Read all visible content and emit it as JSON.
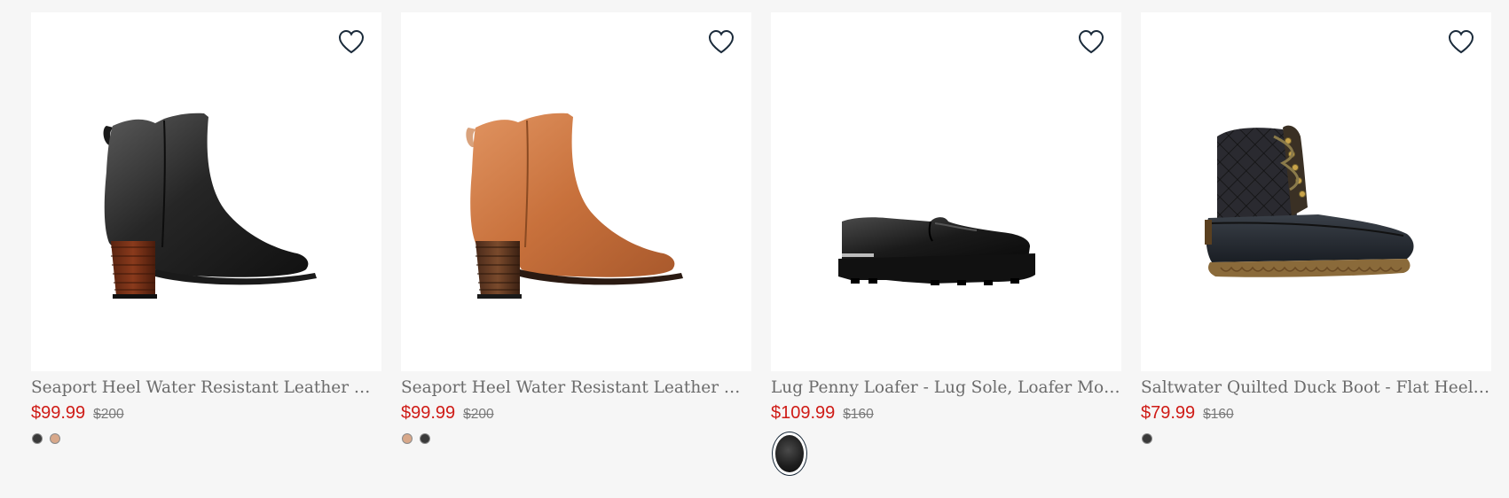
{
  "products": [
    {
      "name": "Seaport Heel Water Resistant Leather Boot - Heeled Bootie, Leather Ankle Boot",
      "sale_price": "$99.99",
      "original_price": "$200",
      "image_icon": "black-heeled-ankle-boot",
      "swatches": [
        {
          "name": "black",
          "color": "#3a3a3a"
        },
        {
          "name": "tan",
          "color": "#d8a88a"
        }
      ]
    },
    {
      "name": "Seaport Heel Water Resistant Leather Boot - Heeled Bootie, Leather Ankle Boot",
      "sale_price": "$99.99",
      "original_price": "$200",
      "image_icon": "tan-heeled-ankle-boot",
      "swatches": [
        {
          "name": "tan",
          "color": "#d8a88a"
        },
        {
          "name": "black",
          "color": "#3a3a3a"
        }
      ]
    },
    {
      "name": "Lug Penny Loafer - Lug Sole, Loafer Moccasin",
      "sale_price": "$109.99",
      "original_price": "$160",
      "image_icon": "black-penny-loafer",
      "swatches": [
        {
          "name": "black",
          "color": "#1d1d1d",
          "selected": true
        }
      ]
    },
    {
      "name": "Saltwater Quilted Duck Boot - Flat Heel, Duck Boot",
      "sale_price": "$79.99",
      "original_price": "$160",
      "image_icon": "black-quilted-duck-boot",
      "swatches": [
        {
          "name": "black",
          "color": "#3a3a3a"
        }
      ]
    }
  ],
  "colors": {
    "sale": "#cf1b16",
    "original": "#7a7a7a",
    "name": "#6b6b6b",
    "background": "#f6f6f6",
    "heart_stroke": "#1a2a3a"
  }
}
